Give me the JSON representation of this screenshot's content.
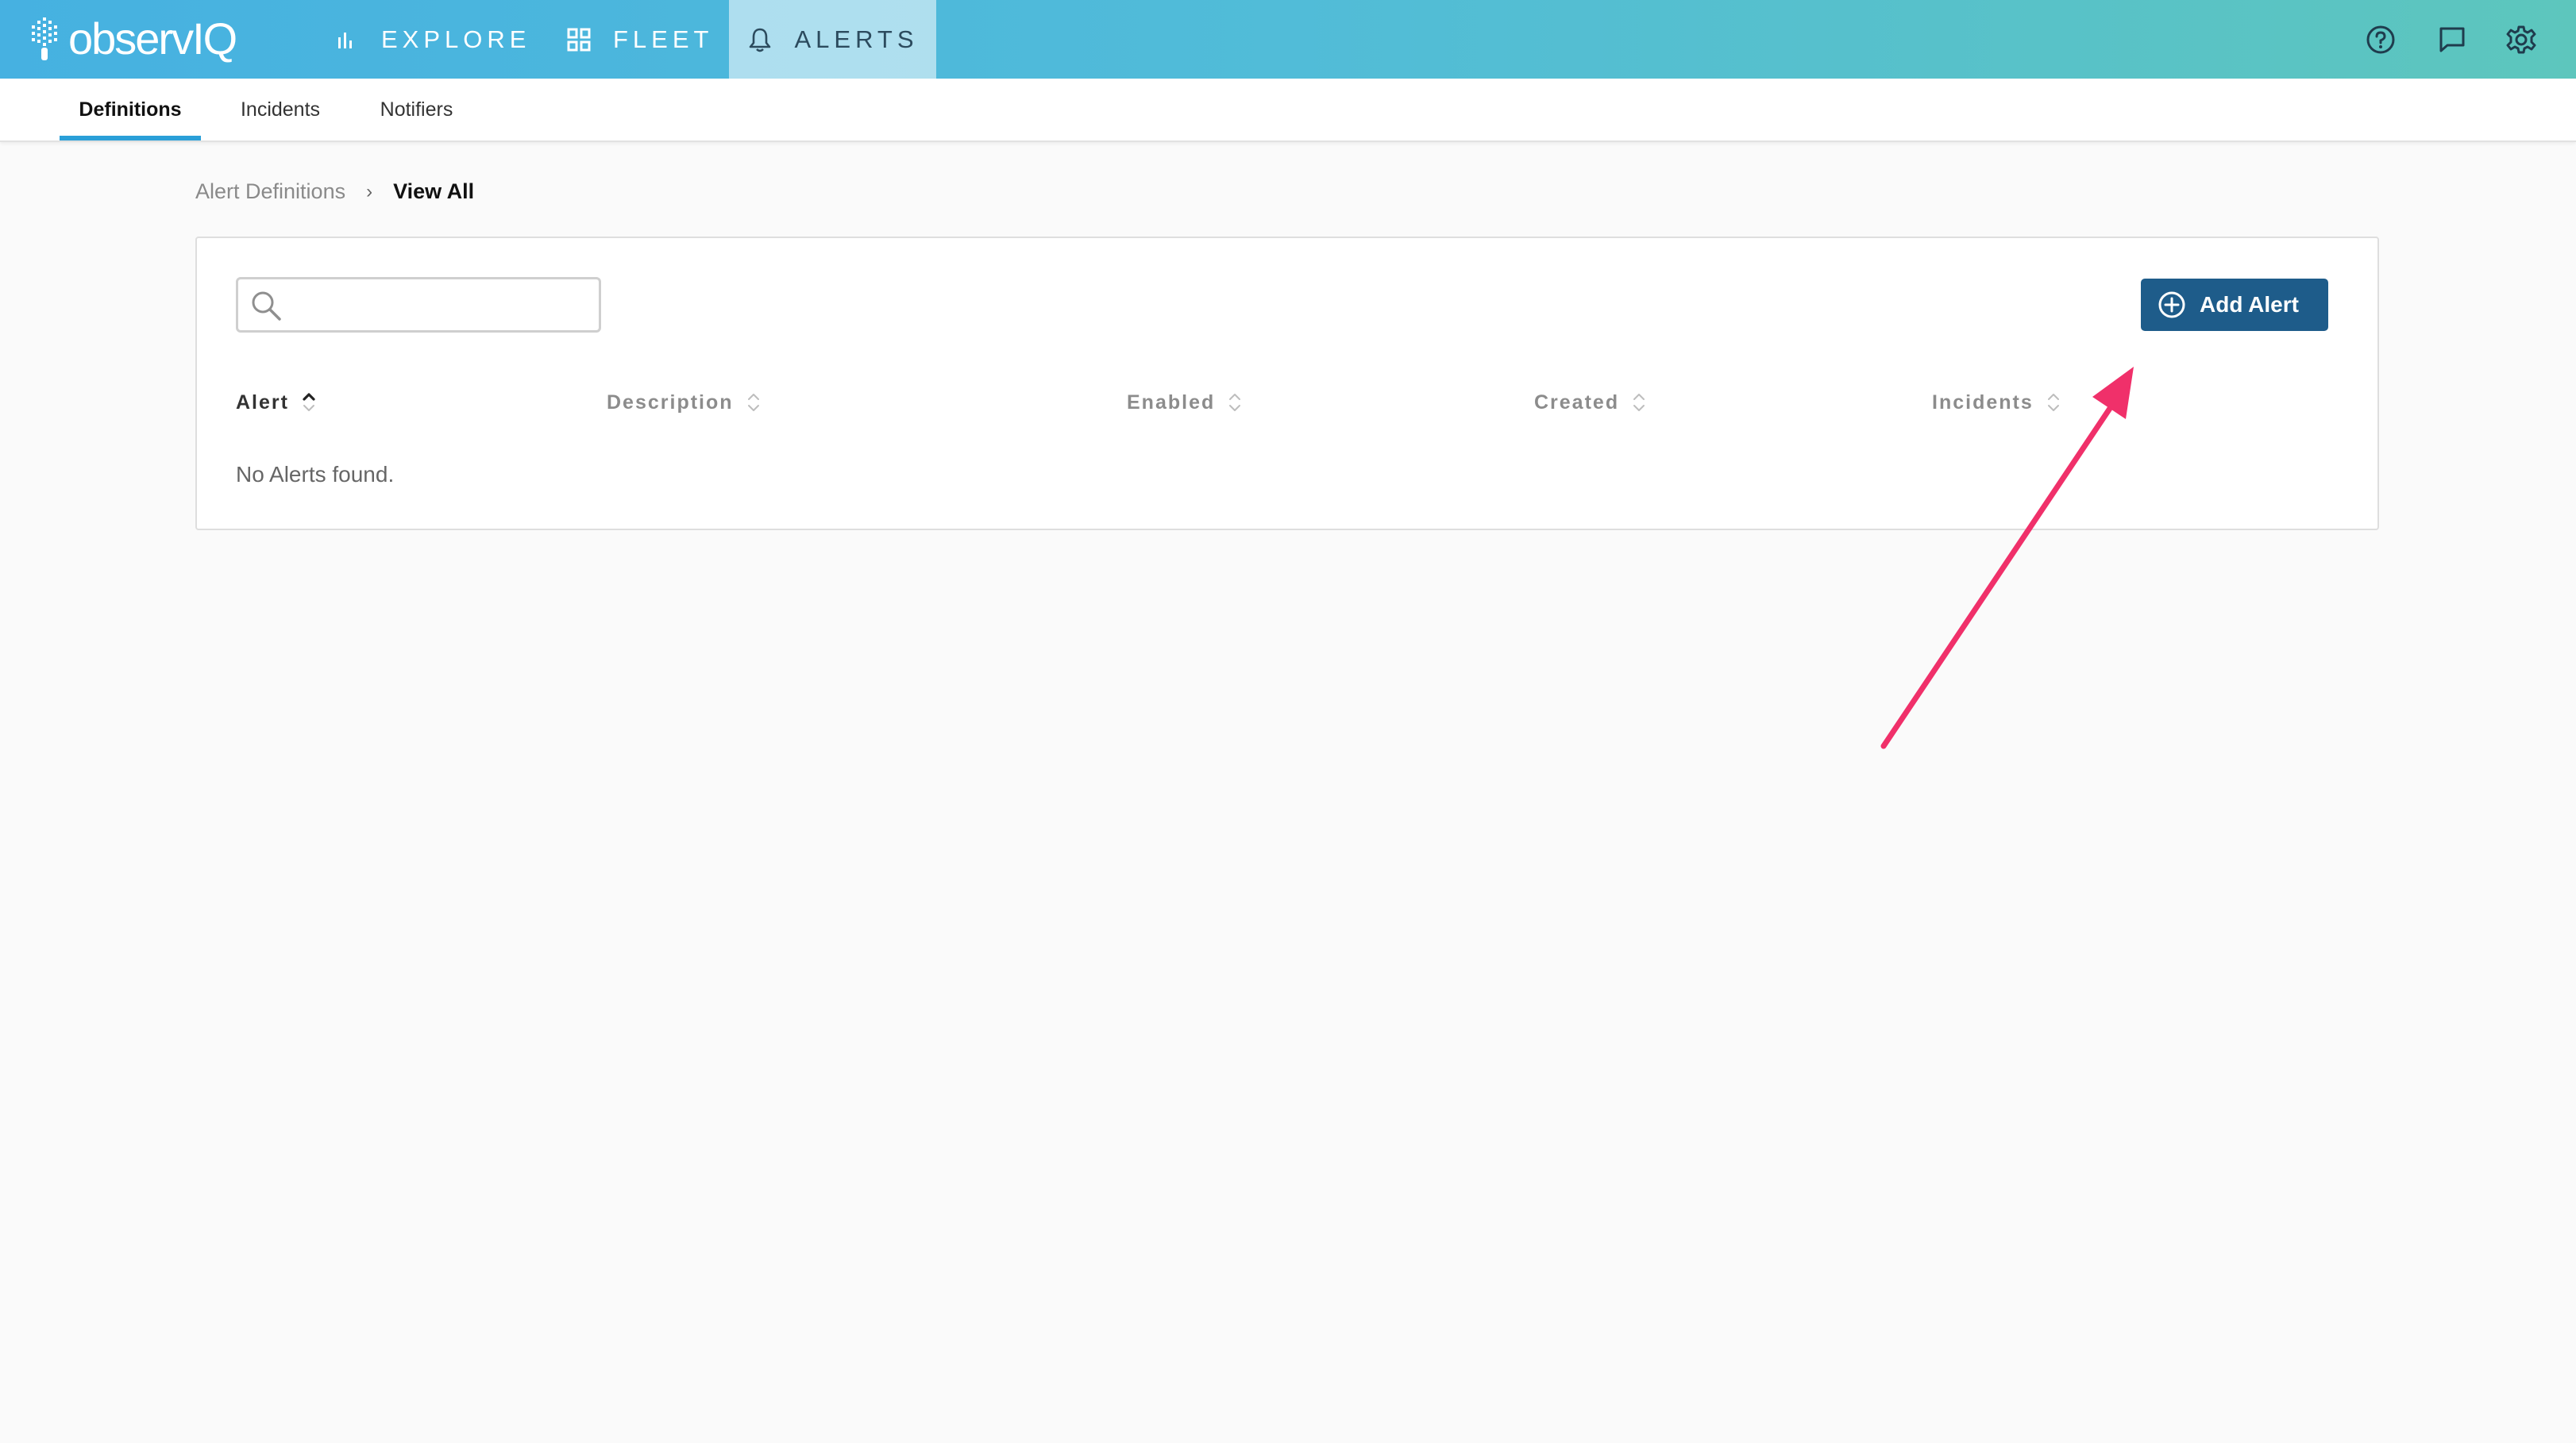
{
  "app": {
    "logo_text": "observIQ",
    "brand_gradient": [
      "#46b1e1",
      "#5dc6bd"
    ],
    "accent_color": "#2a9fd8",
    "button_color": "#1e5c8a",
    "annotation_color": "#f0306a"
  },
  "nav": {
    "explore": {
      "label": "EXPLORE",
      "icon": "bar-chart-icon"
    },
    "fleet": {
      "label": "FLEET",
      "icon": "grid-icon"
    },
    "alerts": {
      "label": "ALERTS",
      "icon": "bell-icon",
      "active": true
    }
  },
  "header_icons": [
    "help-icon",
    "chat-icon",
    "settings-icon"
  ],
  "subnav": {
    "tabs": [
      {
        "label": "Definitions",
        "active": true
      },
      {
        "label": "Incidents",
        "active": false
      },
      {
        "label": "Notifiers",
        "active": false
      }
    ]
  },
  "breadcrumb": {
    "parent": "Alert Definitions",
    "separator": "›",
    "current": "View All"
  },
  "search": {
    "value": "",
    "placeholder": ""
  },
  "add_button": {
    "label": "Add Alert",
    "icon": "plus-circle-icon"
  },
  "table": {
    "columns": [
      "Alert",
      "Description",
      "Enabled",
      "Created",
      "Incidents"
    ],
    "sorted_column": "Alert",
    "sort_direction": "ascending",
    "empty_message": "No Alerts found."
  }
}
